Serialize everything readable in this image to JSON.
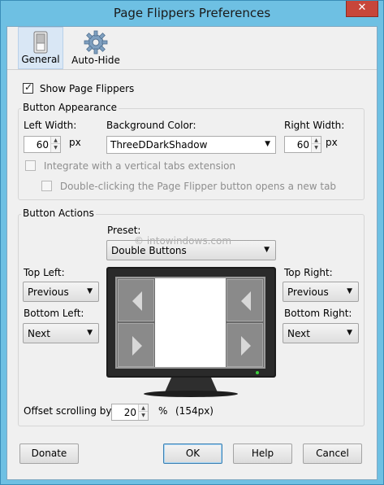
{
  "window": {
    "title": "Page Flippers Preferences",
    "close_glyph": "✕"
  },
  "toolbar": {
    "general": {
      "label": "General",
      "icon": "switch-icon"
    },
    "autohide": {
      "label": "Auto-Hide",
      "icon": "gear-icon"
    }
  },
  "show_flippers": {
    "label": "Show Page Flippers",
    "checked": true
  },
  "appearance": {
    "title": "Button Appearance",
    "left_width": {
      "label": "Left Width:",
      "value": "60",
      "unit": "px"
    },
    "background_color": {
      "label": "Background Color:",
      "value": "ThreeDDarkShadow"
    },
    "right_width": {
      "label": "Right Width:",
      "value": "60",
      "unit": "px"
    },
    "integrate": {
      "label": "Integrate with a vertical tabs extension",
      "checked": false,
      "enabled": false
    },
    "double_click": {
      "label": "Double-clicking the Page Flipper button opens a new tab",
      "checked": false,
      "enabled": false
    }
  },
  "actions": {
    "title": "Button Actions",
    "preset": {
      "label": "Preset:",
      "value": "Double Buttons"
    },
    "top_left": {
      "label": "Top Left:",
      "value": "Previous"
    },
    "bottom_left": {
      "label": "Bottom Left:",
      "value": "Next"
    },
    "top_right": {
      "label": "Top Right:",
      "value": "Previous"
    },
    "bottom_right": {
      "label": "Bottom Right:",
      "value": "Next"
    },
    "offset": {
      "label": "Offset scrolling by:",
      "value": "20",
      "unit": "%",
      "pixels": "(154px)"
    }
  },
  "watermark": "© intowindows.com",
  "buttons": {
    "donate": "Donate",
    "ok": "OK",
    "help": "Help",
    "cancel": "Cancel"
  },
  "colors": {
    "titlebar": "#6ec0e3",
    "dialog": "#f0f0f0",
    "flipper": "#8a8a8a"
  }
}
